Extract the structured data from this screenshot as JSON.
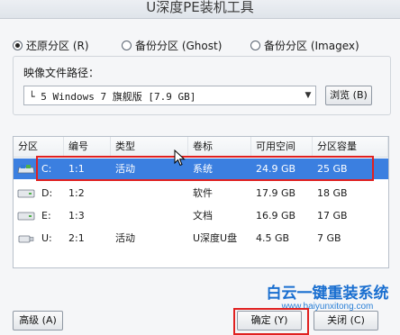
{
  "window": {
    "title": "U深度PE装机工具"
  },
  "modes": [
    {
      "label": "还原分区 (R)",
      "selected": true
    },
    {
      "label": "备份分区 (Ghost)",
      "selected": false
    },
    {
      "label": "备份分区 (Imagex)",
      "selected": false
    }
  ],
  "image_path": {
    "label": "映像文件路径：",
    "value": "└ 5 Windows 7 旗舰版 [7.9 GB]",
    "browse_label": "浏览 (B)"
  },
  "table": {
    "headers": [
      "分区",
      "编号",
      "类型",
      "卷标",
      "可用空间",
      "分区容量"
    ],
    "rows": [
      {
        "drive": "C:",
        "number": "1:1",
        "type": "活动",
        "label": "系统",
        "free": "24.9 GB",
        "capacity": "25 GB",
        "selected": true,
        "icon": "system-disk-icon"
      },
      {
        "drive": "D:",
        "number": "1:2",
        "type": "",
        "label": "软件",
        "free": "17.9 GB",
        "capacity": "18 GB",
        "selected": false,
        "icon": "hard-disk-icon"
      },
      {
        "drive": "E:",
        "number": "1:3",
        "type": "",
        "label": "文档",
        "free": "16.9 GB",
        "capacity": "17 GB",
        "selected": false,
        "icon": "hard-disk-icon"
      },
      {
        "drive": "U:",
        "number": "2:1",
        "type": "活动",
        "label": "U深度U盘",
        "free": "4.5 GB",
        "capacity": "7 GB",
        "selected": false,
        "icon": "usb-disk-icon"
      }
    ]
  },
  "footer": {
    "advanced_label": "高级 (A)",
    "ok_label": "确定 (Y)",
    "close_label": "关闭 (C)"
  },
  "watermark": {
    "title": "白云一键重装系统",
    "url": "www.baiyunxitong.com"
  },
  "colors": {
    "selection": "#3b7fe0",
    "highlight": "#e02020",
    "watermark": "#1a6fd0"
  }
}
